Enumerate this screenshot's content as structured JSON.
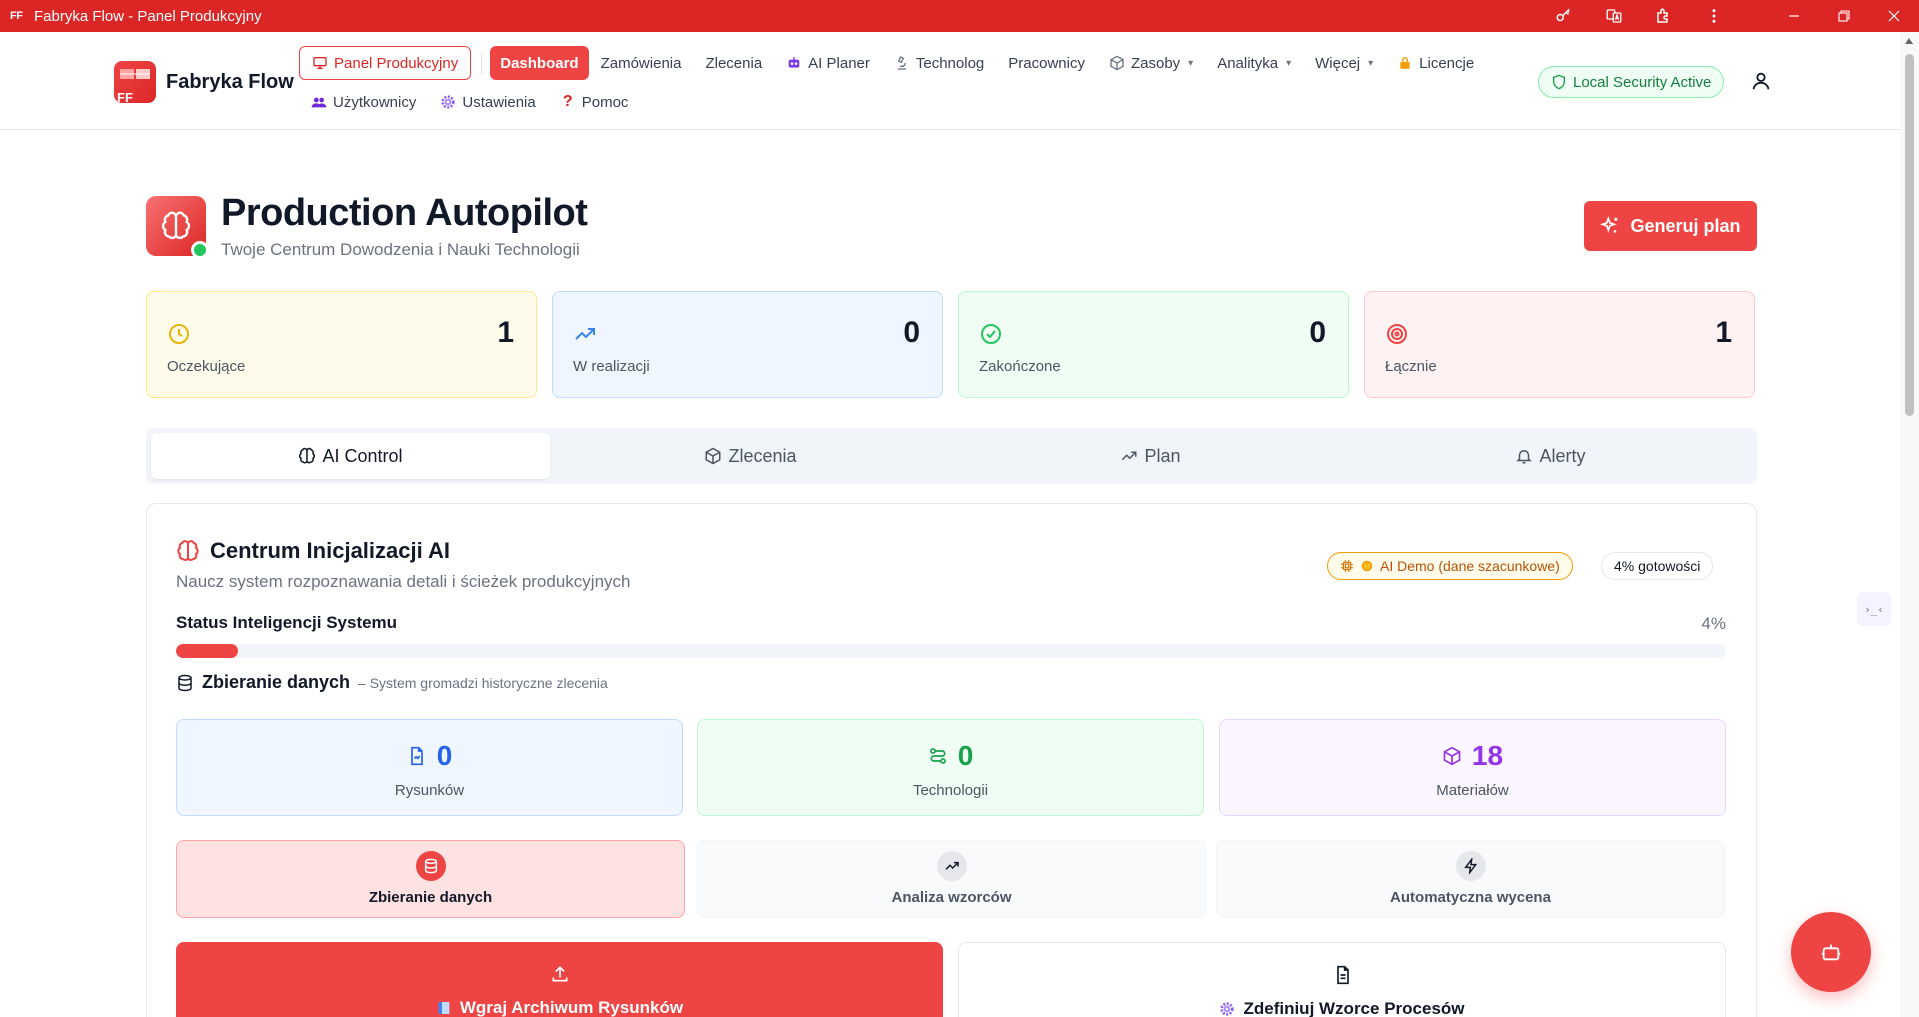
{
  "window": {
    "logo_text": "FF",
    "title": "Fabryka Flow - Panel Produkcyjny"
  },
  "brand": {
    "name": "Fabryka Flow",
    "logo_text": "FF"
  },
  "nav": {
    "panel": "Panel Produkcyjny",
    "dashboard": "Dashboard",
    "zamowienia": "Zamówienia",
    "zlecenia": "Zlecenia",
    "ai_planer": "AI Planer",
    "technolog": "Technolog",
    "pracownicy": "Pracownicy",
    "zasoby": "Zasoby",
    "analityka": "Analityka",
    "wiecej": "Więcej",
    "licencje": "Licencje",
    "uzytkownicy": "Użytkownicy",
    "ustawienia": "Ustawienia",
    "pomoc": "Pomoc",
    "security": "Local Security Active"
  },
  "header": {
    "title": "Production Autopilot",
    "subtitle": "Twoje Centrum Dowodzenia i Nauki Technologii",
    "generate_button": "Generuj plan"
  },
  "stats": [
    {
      "label": "Oczekujące",
      "value": "1",
      "icon": "clock-icon"
    },
    {
      "label": "W realizacji",
      "value": "0",
      "icon": "trending-up-icon"
    },
    {
      "label": "Zakończone",
      "value": "0",
      "icon": "check-circle-icon"
    },
    {
      "label": "Łącznie",
      "value": "1",
      "icon": "target-icon"
    }
  ],
  "tabs": [
    {
      "label": "AI Control",
      "icon": "brain-icon",
      "active": true
    },
    {
      "label": "Zlecenia",
      "icon": "package-icon",
      "active": false
    },
    {
      "label": "Plan",
      "icon": "trending-up-icon",
      "active": false
    },
    {
      "label": "Alerty",
      "icon": "bell-icon",
      "active": false
    }
  ],
  "ai_center": {
    "title": "Centrum Inicjalizacji AI",
    "subtitle": "Naucz system rozpoznawania detali i ścieżek produkcyjnych",
    "demo_badge": "AI Demo (dane szacunkowe)",
    "readiness_badge": "4% gotowości",
    "status_label": "Status Inteligencji Systemu",
    "status_percent": "4%",
    "progress": 0.04,
    "phase_name": "Zbieranie danych",
    "phase_desc": "– System gromadzi historyczne zlecenia",
    "metrics": [
      {
        "value": "0",
        "label": "Rysunków",
        "color": "#2563eb",
        "icon": "file-image-icon"
      },
      {
        "value": "0",
        "label": "Technologii",
        "color": "#16a34a",
        "icon": "route-icon"
      },
      {
        "value": "18",
        "label": "Materiałów",
        "color": "#9333ea",
        "icon": "box-icon"
      }
    ],
    "steps": [
      {
        "label": "Zbieranie danych",
        "icon": "database-icon",
        "active": true
      },
      {
        "label": "Analiza wzorców",
        "icon": "trending-up-icon",
        "active": false
      },
      {
        "label": "Automatyczna wycena",
        "icon": "zap-icon",
        "active": false
      }
    ],
    "upload_label": "Wgraj Archiwum Rysunków",
    "define_label": "Zdefiniuj Wzorce Procesów"
  },
  "side_widget": "›_‹",
  "colors": {
    "accent": "#ef4444",
    "titlebar": "#dc2626",
    "success": "#22c55e"
  }
}
